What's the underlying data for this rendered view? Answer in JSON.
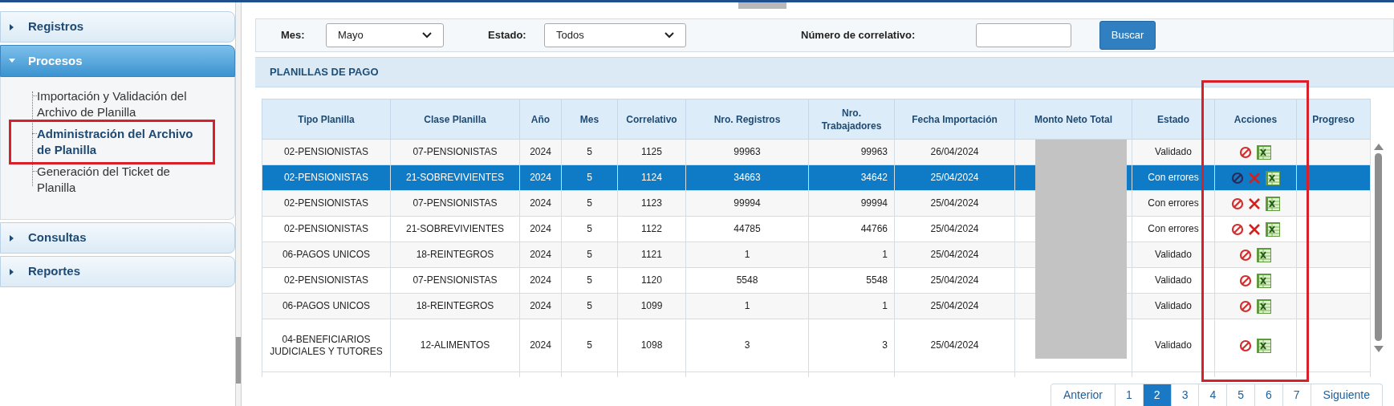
{
  "sidebar": {
    "sections": [
      {
        "label": "Registros",
        "expanded": false
      },
      {
        "label": "Procesos",
        "expanded": true,
        "children": [
          {
            "label": "Importación y Validación del Archivo de Planilla",
            "selected": false,
            "highlighted": false
          },
          {
            "label": "Administración del Archivo de Planilla",
            "selected": true,
            "highlighted": true
          },
          {
            "label": "Generación del Ticket de Planilla",
            "selected": false,
            "highlighted": false
          }
        ]
      },
      {
        "label": "Consultas",
        "expanded": false
      },
      {
        "label": "Reportes",
        "expanded": false
      }
    ]
  },
  "filters": {
    "mes": {
      "label": "Mes:",
      "value": "Mayo"
    },
    "estado": {
      "label": "Estado:",
      "value": "Todos"
    },
    "correlativo": {
      "label": "Número de correlativo:"
    },
    "search_button": "Buscar"
  },
  "panel_title": "PLANILLAS DE PAGO",
  "table": {
    "columns": [
      {
        "label": "Tipo Planilla",
        "highlighted": false
      },
      {
        "label": "Clase Planilla",
        "highlighted": false
      },
      {
        "label": "Año",
        "highlighted": false
      },
      {
        "label": "Mes",
        "highlighted": false
      },
      {
        "label": "Correlativo",
        "highlighted": false
      },
      {
        "label": "Nro. Registros",
        "highlighted": false
      },
      {
        "label": "Nro. Trabajadores",
        "highlighted": false
      },
      {
        "label": "Fecha Importación",
        "highlighted": false
      },
      {
        "label": "Monto Neto Total",
        "highlighted": false
      },
      {
        "label": "Estado",
        "highlighted": false
      },
      {
        "label": "Acciones",
        "highlighted": true
      },
      {
        "label": "Progreso",
        "highlighted": false
      }
    ],
    "rows": [
      {
        "cells": [
          "02-PENSIONISTAS",
          "07-PENSIONISTAS",
          "2024",
          "5",
          "1125",
          "99963",
          "99963",
          "26/04/2024",
          "Validado"
        ],
        "actions": [
          {
            "kind": "cancel"
          },
          {
            "kind": "excel"
          }
        ],
        "selected": false
      },
      {
        "cells": [
          "02-PENSIONISTAS",
          "21-SOBREVIVIENTES",
          "2024",
          "5",
          "1124",
          "34663",
          "34642",
          "25/04/2024",
          "Con errores"
        ],
        "actions": [
          {
            "kind": "cancel"
          },
          {
            "kind": "delete"
          },
          {
            "kind": "excel"
          }
        ],
        "selected": true
      },
      {
        "cells": [
          "02-PENSIONISTAS",
          "07-PENSIONISTAS",
          "2024",
          "5",
          "1123",
          "99994",
          "99994",
          "25/04/2024",
          "Con errores"
        ],
        "actions": [
          {
            "kind": "cancel"
          },
          {
            "kind": "delete"
          },
          {
            "kind": "excel"
          }
        ],
        "selected": false
      },
      {
        "cells": [
          "02-PENSIONISTAS",
          "21-SOBREVIVIENTES",
          "2024",
          "5",
          "1122",
          "44785",
          "44766",
          "25/04/2024",
          "Con errores"
        ],
        "actions": [
          {
            "kind": "cancel"
          },
          {
            "kind": "delete"
          },
          {
            "kind": "excel"
          }
        ],
        "selected": false
      },
      {
        "cells": [
          "06-PAGOS UNICOS",
          "18-REINTEGROS",
          "2024",
          "5",
          "1121",
          "1",
          "1",
          "25/04/2024",
          "Validado"
        ],
        "actions": [
          {
            "kind": "cancel"
          },
          {
            "kind": "excel"
          }
        ],
        "selected": false
      },
      {
        "cells": [
          "02-PENSIONISTAS",
          "07-PENSIONISTAS",
          "2024",
          "5",
          "1120",
          "5548",
          "5548",
          "25/04/2024",
          "Validado"
        ],
        "actions": [
          {
            "kind": "cancel"
          },
          {
            "kind": "excel"
          }
        ],
        "selected": false
      },
      {
        "cells": [
          "06-PAGOS UNICOS",
          "18-REINTEGROS",
          "2024",
          "5",
          "1099",
          "1",
          "1",
          "25/04/2024",
          "Validado"
        ],
        "actions": [
          {
            "kind": "cancel"
          },
          {
            "kind": "excel"
          }
        ],
        "selected": false
      },
      {
        "cells": [
          "04-BENEFICIARIOS JUDICIALES Y TUTORES",
          "12-ALIMENTOS",
          "2024",
          "5",
          "1098",
          "3",
          "3",
          "25/04/2024",
          "Validado"
        ],
        "actions": [
          {
            "kind": "cancel"
          },
          {
            "kind": "excel"
          }
        ],
        "selected": false
      }
    ]
  },
  "pagination": {
    "previous": "Anterior",
    "next": "Siguiente",
    "pages": [
      {
        "label": "1",
        "selected": false
      },
      {
        "label": "2",
        "selected": true
      },
      {
        "label": "3",
        "selected": false
      },
      {
        "label": "4",
        "selected": false
      },
      {
        "label": "5",
        "selected": false
      },
      {
        "label": "6",
        "selected": false
      },
      {
        "label": "7",
        "selected": false
      }
    ]
  }
}
